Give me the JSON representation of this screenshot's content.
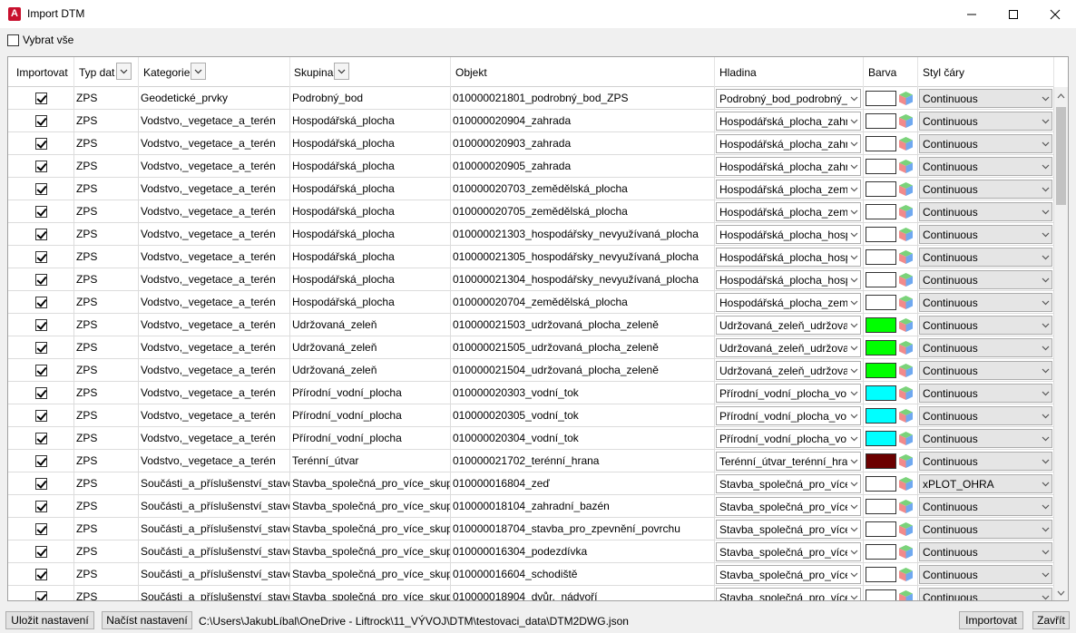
{
  "window": {
    "title": "Import DTM",
    "app_icon_letter": "A"
  },
  "toolbar": {
    "select_all_label": "Vybrat vše",
    "select_all_checked": false
  },
  "columns": [
    "Importovat",
    "Typ dat",
    "Kategorie",
    "Skupina",
    "Objekt",
    "Hladina",
    "Barva",
    "Styl čáry"
  ],
  "rows": [
    {
      "checked": true,
      "type": "ZPS",
      "category": "Geodetické_prvky",
      "group": "Podrobný_bod",
      "object": "010000021801_podrobný_bod_ZPS",
      "layer": "Podrobný_bod_podrobný_",
      "color": "#ffffff",
      "linestyle": "Continuous"
    },
    {
      "checked": true,
      "type": "ZPS",
      "category": "Vodstvo,_vegetace_a_terén",
      "group": "Hospodářská_plocha",
      "object": "010000020904_zahrada",
      "layer": "Hospodářská_plocha_zahr",
      "color": "#ffffff",
      "linestyle": "Continuous"
    },
    {
      "checked": true,
      "type": "ZPS",
      "category": "Vodstvo,_vegetace_a_terén",
      "group": "Hospodářská_plocha",
      "object": "010000020903_zahrada",
      "layer": "Hospodářská_plocha_zahr",
      "color": "#ffffff",
      "linestyle": "Continuous"
    },
    {
      "checked": true,
      "type": "ZPS",
      "category": "Vodstvo,_vegetace_a_terén",
      "group": "Hospodářská_plocha",
      "object": "010000020905_zahrada",
      "layer": "Hospodářská_plocha_zahr",
      "color": "#ffffff",
      "linestyle": "Continuous"
    },
    {
      "checked": true,
      "type": "ZPS",
      "category": "Vodstvo,_vegetace_a_terén",
      "group": "Hospodářská_plocha",
      "object": "010000020703_zemědělská_plocha",
      "layer": "Hospodářská_plocha_zem",
      "color": "#ffffff",
      "linestyle": "Continuous"
    },
    {
      "checked": true,
      "type": "ZPS",
      "category": "Vodstvo,_vegetace_a_terén",
      "group": "Hospodářská_plocha",
      "object": "010000020705_zemědělská_plocha",
      "layer": "Hospodářská_plocha_zem",
      "color": "#ffffff",
      "linestyle": "Continuous"
    },
    {
      "checked": true,
      "type": "ZPS",
      "category": "Vodstvo,_vegetace_a_terén",
      "group": "Hospodářská_plocha",
      "object": "010000021303_hospodářsky_nevyužívaná_plocha",
      "layer": "Hospodářská_plocha_hosp",
      "color": "#ffffff",
      "linestyle": "Continuous"
    },
    {
      "checked": true,
      "type": "ZPS",
      "category": "Vodstvo,_vegetace_a_terén",
      "group": "Hospodářská_plocha",
      "object": "010000021305_hospodářsky_nevyužívaná_plocha",
      "layer": "Hospodářská_plocha_hosp",
      "color": "#ffffff",
      "linestyle": "Continuous"
    },
    {
      "checked": true,
      "type": "ZPS",
      "category": "Vodstvo,_vegetace_a_terén",
      "group": "Hospodářská_plocha",
      "object": "010000021304_hospodářsky_nevyužívaná_plocha",
      "layer": "Hospodářská_plocha_hosp",
      "color": "#ffffff",
      "linestyle": "Continuous"
    },
    {
      "checked": true,
      "type": "ZPS",
      "category": "Vodstvo,_vegetace_a_terén",
      "group": "Hospodářská_plocha",
      "object": "010000020704_zemědělská_plocha",
      "layer": "Hospodářská_plocha_zem",
      "color": "#ffffff",
      "linestyle": "Continuous"
    },
    {
      "checked": true,
      "type": "ZPS",
      "category": "Vodstvo,_vegetace_a_terén",
      "group": "Udržovaná_zeleň",
      "object": "010000021503_udržovaná_plocha_zeleně",
      "layer": "Udržovaná_zeleň_udržova",
      "color": "#00ff00",
      "linestyle": "Continuous"
    },
    {
      "checked": true,
      "type": "ZPS",
      "category": "Vodstvo,_vegetace_a_terén",
      "group": "Udržovaná_zeleň",
      "object": "010000021505_udržovaná_plocha_zeleně",
      "layer": "Udržovaná_zeleň_udržova",
      "color": "#00ff00",
      "linestyle": "Continuous"
    },
    {
      "checked": true,
      "type": "ZPS",
      "category": "Vodstvo,_vegetace_a_terén",
      "group": "Udržovaná_zeleň",
      "object": "010000021504_udržovaná_plocha_zeleně",
      "layer": "Udržovaná_zeleň_udržova",
      "color": "#00ff00",
      "linestyle": "Continuous"
    },
    {
      "checked": true,
      "type": "ZPS",
      "category": "Vodstvo,_vegetace_a_terén",
      "group": "Přírodní_vodní_plocha",
      "object": "010000020303_vodní_tok",
      "layer": "Přírodní_vodní_plocha_vo",
      "color": "#00ffff",
      "linestyle": "Continuous"
    },
    {
      "checked": true,
      "type": "ZPS",
      "category": "Vodstvo,_vegetace_a_terén",
      "group": "Přírodní_vodní_plocha",
      "object": "010000020305_vodní_tok",
      "layer": "Přírodní_vodní_plocha_vo",
      "color": "#00ffff",
      "linestyle": "Continuous"
    },
    {
      "checked": true,
      "type": "ZPS",
      "category": "Vodstvo,_vegetace_a_terén",
      "group": "Přírodní_vodní_plocha",
      "object": "010000020304_vodní_tok",
      "layer": "Přírodní_vodní_plocha_vo",
      "color": "#00ffff",
      "linestyle": "Continuous"
    },
    {
      "checked": true,
      "type": "ZPS",
      "category": "Vodstvo,_vegetace_a_terén",
      "group": "Terénní_útvar",
      "object": "010000021702_terénní_hrana",
      "layer": "Terénní_útvar_terénní_hran",
      "color": "#6b0000",
      "linestyle": "Continuous"
    },
    {
      "checked": true,
      "type": "ZPS",
      "category": "Součásti_a_příslušenství_staveb",
      "group": "Stavba_společná_pro_více_skupin",
      "object": "010000016804_zeď",
      "layer": "Stavba_společná_pro_více_",
      "color": "#ffffff",
      "linestyle": "xPLOT_OHRA"
    },
    {
      "checked": true,
      "type": "ZPS",
      "category": "Součásti_a_příslušenství_staveb",
      "group": "Stavba_společná_pro_více_skupin",
      "object": "010000018104_zahradní_bazén",
      "layer": "Stavba_společná_pro_více_",
      "color": "#ffffff",
      "linestyle": "Continuous"
    },
    {
      "checked": true,
      "type": "ZPS",
      "category": "Součásti_a_příslušenství_staveb",
      "group": "Stavba_společná_pro_více_skupin",
      "object": "010000018704_stavba_pro_zpevnění_povrchu",
      "layer": "Stavba_společná_pro_více_",
      "color": "#ffffff",
      "linestyle": "Continuous"
    },
    {
      "checked": true,
      "type": "ZPS",
      "category": "Součásti_a_příslušenství_staveb",
      "group": "Stavba_společná_pro_více_skupin",
      "object": "010000016304_podezdívka",
      "layer": "Stavba_společná_pro_více_",
      "color": "#ffffff",
      "linestyle": "Continuous"
    },
    {
      "checked": true,
      "type": "ZPS",
      "category": "Součásti_a_příslušenství_staveb",
      "group": "Stavba_společná_pro_více_skupin",
      "object": "010000016604_schodiště",
      "layer": "Stavba_společná_pro_více_",
      "color": "#ffffff",
      "linestyle": "Continuous"
    },
    {
      "checked": true,
      "type": "ZPS",
      "category": "Součásti_a_příslušenství_staveb",
      "group": "Stavba_společná_pro_více_skupin",
      "object": "010000018904_dvůr,_nádvoří",
      "layer": "Stavba_společná_pro_více_",
      "color": "#ffffff",
      "linestyle": "Continuous"
    }
  ],
  "footer": {
    "save_label": "Uložit nastavení",
    "load_label": "Načíst nastavení",
    "path": "C:\\Users\\JakubLíbal\\OneDrive - Liftrock\\11_VÝVOJ\\DTM\\testovaci_data\\DTM2DWG.json",
    "import_label": "Importovat",
    "close_label": "Zavřít"
  }
}
